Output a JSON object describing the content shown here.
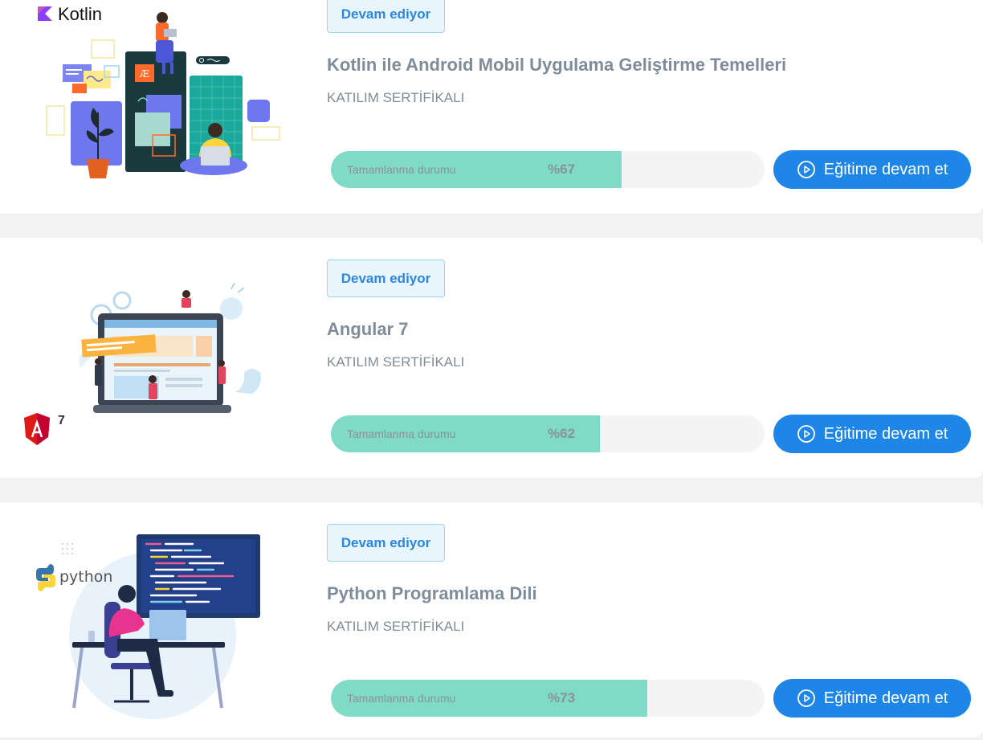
{
  "courses": [
    {
      "status": "Devam ediyor",
      "title": "Kotlin ile Android Mobil Uygulama Geliştirme Temelleri",
      "certificate": "KATILIM SERTİFİKALI",
      "progress_label": "Tamamlanma durumu",
      "progress_percent_text": "%67",
      "progress_value": 67,
      "button_label": "Eğitime devam et",
      "logo_text": "Kotlin",
      "play_icon": "play-circle-icon"
    },
    {
      "status": "Devam ediyor",
      "title": "Angular 7",
      "certificate": "KATILIM SERTİFİKALI",
      "progress_label": "Tamamlanma durumu",
      "progress_percent_text": "%62",
      "progress_value": 62,
      "button_label": "Eğitime devam et",
      "logo_text": "7",
      "play_icon": "play-circle-icon"
    },
    {
      "status": "Devam ediyor",
      "title": "Python Programlama Dili",
      "certificate": "KATILIM SERTİFİKALI",
      "progress_label": "Tamamlanma durumu",
      "progress_percent_text": "%73",
      "progress_value": 73,
      "button_label": "Eğitime devam et",
      "logo_text": "python",
      "play_icon": "play-circle-icon"
    }
  ],
  "colors": {
    "accent": "#1e86e6",
    "progress_fill": "#7fdac7",
    "badge_bg": "#e9f5fd",
    "text_muted": "#7f8c99"
  }
}
